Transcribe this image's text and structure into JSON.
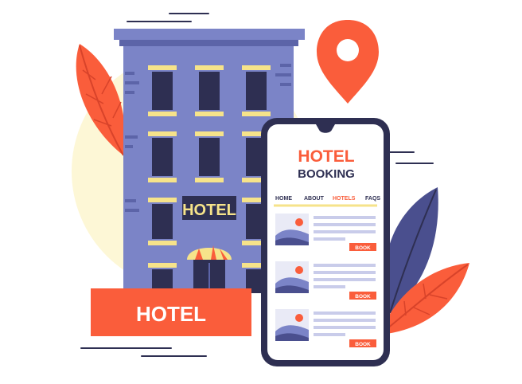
{
  "building": {
    "sign_text": "HOTEL"
  },
  "banner": {
    "label": "HOTEL"
  },
  "phone": {
    "title_line1": "HOTEL",
    "title_line2": "BOOKING",
    "nav": [
      {
        "label": "HOME"
      },
      {
        "label": "ABOUT"
      },
      {
        "label": "HOTELS",
        "active": true
      },
      {
        "label": "FAQS"
      }
    ],
    "listings": [
      {
        "book_label": "BOOK"
      },
      {
        "book_label": "BOOK"
      },
      {
        "book_label": "BOOK"
      }
    ]
  },
  "icons": {
    "pin": "location-pin-icon",
    "leaf": "leaf-icon"
  },
  "colors": {
    "accent": "#fa5d3b",
    "building": "#7b84c7",
    "building_dark": "#4a4f8e",
    "phone_frame": "#2e2f52",
    "sign": "#f6e38a",
    "sun_glow": "#fdf7d2"
  }
}
